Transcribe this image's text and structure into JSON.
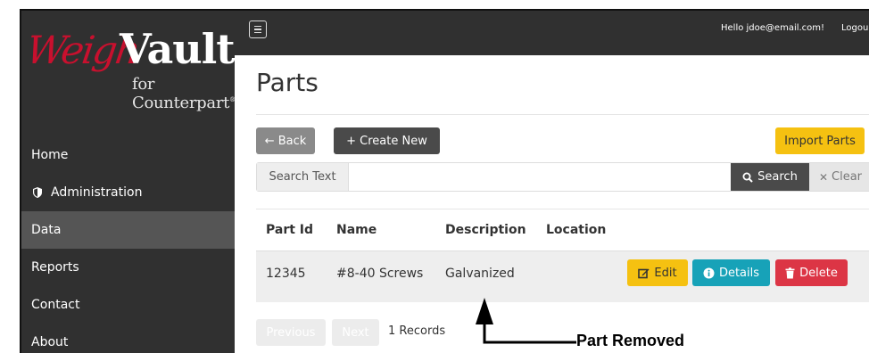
{
  "brand": {
    "logo_part1": "Weigh",
    "logo_part2": "Vault",
    "logo_sub": "for Counterpart",
    "logo_reg": "®",
    "colors": {
      "red": "#c8102e",
      "dark": "#303030"
    }
  },
  "sidebar": {
    "items": [
      {
        "label": "Home",
        "icon": ""
      },
      {
        "label": "Administration",
        "icon": "shield-icon"
      },
      {
        "label": "Data",
        "icon": "",
        "active": true
      },
      {
        "label": "Reports",
        "icon": ""
      },
      {
        "label": "Contact",
        "icon": ""
      },
      {
        "label": "About",
        "icon": ""
      }
    ]
  },
  "topbar": {
    "menu_icon": "hamburger-icon",
    "greeting": "Hello jdoe@email.com!",
    "logout": "Logou"
  },
  "main": {
    "title": "Parts",
    "toolbar": {
      "back_label": "← Back",
      "create_label": "+ Create New",
      "import_label": "Import Parts"
    },
    "search": {
      "label": "Search Text",
      "value": "",
      "search_label": "Search",
      "clear_label": "Clear"
    },
    "table": {
      "headers": [
        "Part Id",
        "Name",
        "Description",
        "Location"
      ],
      "rows": [
        {
          "part_id": "12345",
          "name": "#8-40 Screws",
          "description": "Galvanized",
          "location": ""
        }
      ],
      "actions": {
        "edit": "Edit",
        "details": "Details",
        "delete": "Delete"
      }
    },
    "pagination": {
      "previous": "Previous",
      "next": "Next",
      "records": "1 Records"
    }
  },
  "annotation": {
    "text": "Part Removed"
  }
}
